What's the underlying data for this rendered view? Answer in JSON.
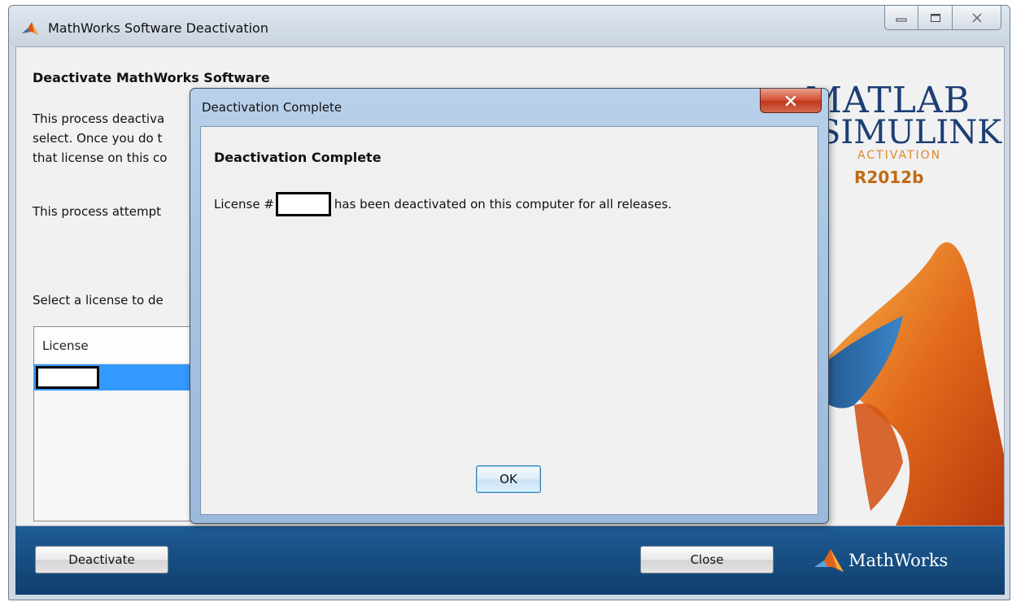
{
  "main_window": {
    "title": "MathWorks Software Deactivation",
    "icon": "matlab-membrane-icon",
    "controls": {
      "minimize": "minimize-icon",
      "maximize": "maximize-icon",
      "close": "close-icon"
    }
  },
  "content": {
    "heading": "Deactivate MathWorks Software",
    "paragraph_lines": [
      "This process deactiva",
      "select. Once you do t",
      "that license on this co"
    ],
    "paragraph2": "This process attempt",
    "select_label": "Select a license to de",
    "table": {
      "column_header": "License",
      "rows": [
        {
          "license": "",
          "selected": true
        }
      ]
    }
  },
  "logo": {
    "matlab": "MATLAB",
    "simulink": "SIMULINK",
    "activation": "ACTIVATION",
    "release": "R2012b"
  },
  "footer": {
    "deactivate_label": "Deactivate",
    "close_label": "Close",
    "brand": "MathWorks"
  },
  "dialog": {
    "title": "Deactivation Complete",
    "heading": "Deactivation Complete",
    "message_prefix": "License #",
    "message_suffix": "has been deactivated on this computer for all releases.",
    "ok_label": "OK"
  },
  "colors": {
    "selection": "#3399ff",
    "footer_bg": "#1e5c94",
    "matlab_blue": "#1c3e74",
    "activation_orange": "#d98a2b"
  }
}
